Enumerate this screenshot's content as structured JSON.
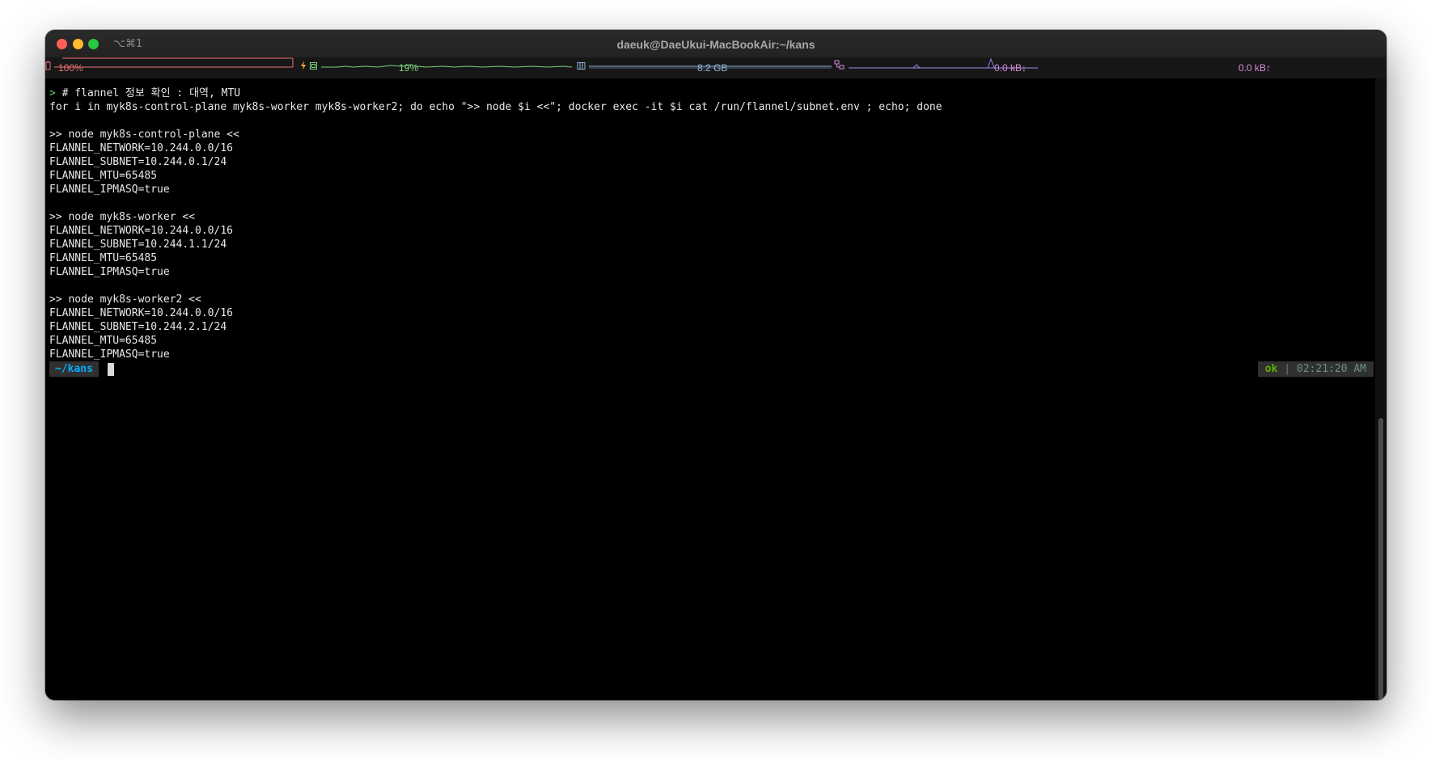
{
  "window": {
    "title": "daeuk@DaeUkui-MacBookAir:~/kans",
    "shortcut": "⌥⌘1"
  },
  "statusbar": {
    "battery": {
      "label": "100%",
      "level": 1.0,
      "color": "#e87373"
    },
    "cpu": {
      "label": "19%",
      "color": "#7fd07f"
    },
    "memory": {
      "label": "8.2 GB",
      "color": "#8fb3d9"
    },
    "network": {
      "down_label": "0.0 kB↓",
      "up_label": "0.0 kB↑",
      "color": "#d28bd6"
    }
  },
  "terminal": {
    "lines": [
      {
        "prompt": "> ",
        "text": "# flannel 정보 확인 : 대역, MTU"
      },
      {
        "prompt": "",
        "text": "for i in myk8s-control-plane myk8s-worker myk8s-worker2; do echo \">> node $i <<\"; docker exec -it $i cat /run/flannel/subnet.env ; echo; done"
      },
      {
        "prompt": "",
        "text": ""
      },
      {
        "prompt": "",
        "text": ">> node myk8s-control-plane <<"
      },
      {
        "prompt": "",
        "text": "FLANNEL_NETWORK=10.244.0.0/16"
      },
      {
        "prompt": "",
        "text": "FLANNEL_SUBNET=10.244.0.1/24"
      },
      {
        "prompt": "",
        "text": "FLANNEL_MTU=65485"
      },
      {
        "prompt": "",
        "text": "FLANNEL_IPMASQ=true"
      },
      {
        "prompt": "",
        "text": ""
      },
      {
        "prompt": "",
        "text": ">> node myk8s-worker <<"
      },
      {
        "prompt": "",
        "text": "FLANNEL_NETWORK=10.244.0.0/16"
      },
      {
        "prompt": "",
        "text": "FLANNEL_SUBNET=10.244.1.1/24"
      },
      {
        "prompt": "",
        "text": "FLANNEL_MTU=65485"
      },
      {
        "prompt": "",
        "text": "FLANNEL_IPMASQ=true"
      },
      {
        "prompt": "",
        "text": ""
      },
      {
        "prompt": "",
        "text": ">> node myk8s-worker2 <<"
      },
      {
        "prompt": "",
        "text": "FLANNEL_NETWORK=10.244.0.0/16"
      },
      {
        "prompt": "",
        "text": "FLANNEL_SUBNET=10.244.2.1/24"
      },
      {
        "prompt": "",
        "text": "FLANNEL_MTU=65485"
      },
      {
        "prompt": "",
        "text": "FLANNEL_IPMASQ=true"
      }
    ],
    "current_dir": "~/kans",
    "status": "ok",
    "separator": "|",
    "time": "02:21:20 AM"
  }
}
